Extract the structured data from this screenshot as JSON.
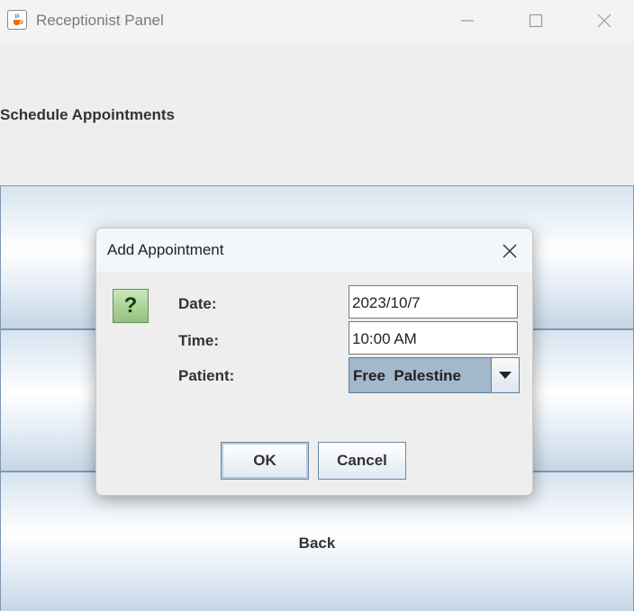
{
  "window": {
    "title": "Receptionist Panel",
    "icon": "java-cup-icon"
  },
  "main": {
    "heading": "Schedule Appointments",
    "back_label": "Back"
  },
  "dialog": {
    "title": "Add Appointment",
    "icon": "question-icon",
    "icon_glyph": "?",
    "date_label": "Date:",
    "date_value": "2023/10/7",
    "time_label": "Time:",
    "time_value": "10:00 AM",
    "patient_label": "Patient:",
    "patient_value": "Free  Palestine",
    "ok_label": "OK",
    "cancel_label": "Cancel"
  }
}
